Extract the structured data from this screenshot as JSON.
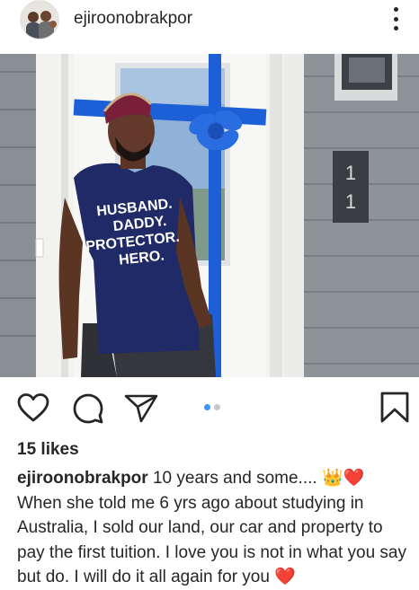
{
  "post": {
    "username": "ejiroonobrakpor",
    "likes": "15 likes",
    "caption_user": "ejiroonobrakpor",
    "caption_text": " 10 years and some.... 👑❤️ When she told me 6 yrs ago about studying in Australia, I sold our land, our car and property to pay the first tuition. I love you is not in what you say but do. I will do it all again for you ❤️"
  },
  "photo": {
    "house_number": "11",
    "shirt_lines": [
      "HUSBAND.",
      "DADDY.",
      "PROTECTOR.",
      "HERO."
    ]
  },
  "icons": {
    "like": "heart-outline-icon",
    "comment": "comment-bubble-icon",
    "share": "paper-plane-icon",
    "save": "bookmark-outline-icon",
    "more": "vertical-ellipsis-icon"
  },
  "carousel": {
    "count": 2,
    "active": 1
  },
  "colors": {
    "carousel_active": "#3897f0",
    "ribbon": "#1c5fd6",
    "siding": "#8e9398"
  }
}
